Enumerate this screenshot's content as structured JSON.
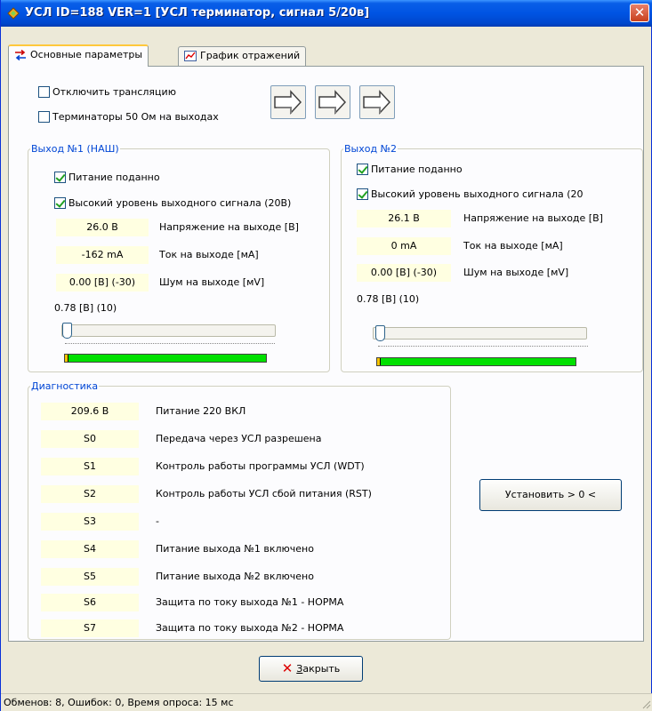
{
  "window": {
    "title": "УСЛ ID=188 VER=1 [УСЛ терминатор, сигнал 5/20в]",
    "close_glyph": "✕"
  },
  "tabs": [
    {
      "label": "Основные параметры",
      "active": true,
      "icon": "arrows-icon"
    },
    {
      "label": "График отражений",
      "active": false,
      "icon": "chart-icon"
    }
  ],
  "top_options": {
    "disable_translation": {
      "label": "Отключить трансляцию",
      "checked": false
    },
    "terminators": {
      "label": "Терминаторы 50 Ом на выходах",
      "checked": false
    }
  },
  "output1": {
    "legend": "Выход №1 (НАШ)",
    "power": {
      "label": "Питание поданно",
      "checked": true
    },
    "high_level": {
      "label": "Высокий уровень выходного сигнала (20В)",
      "checked": true
    },
    "rows": [
      {
        "value": "26.0 В",
        "label": "Напряжение на выходе  [В]"
      },
      {
        "value": "-162 mA",
        "label": "Ток на выходе  [мА]"
      },
      {
        "value": "0.00 [В] (-30)",
        "label": "Шум на выходе  [мV]"
      }
    ],
    "level_text": "0.78 [В] (10)",
    "slider_value": 0,
    "level_bar_fill": 1.0
  },
  "output2": {
    "legend": "Выход №2",
    "power": {
      "label": "Питание поданно",
      "checked": true
    },
    "high_level": {
      "label": "Высокий уровень выходного сигнала (20",
      "checked": true
    },
    "rows": [
      {
        "value": "26.1 В",
        "label": "Напряжение на выходе  [В]"
      },
      {
        "value": "0 mA",
        "label": "Ток на выходе  [мА]"
      },
      {
        "value": "0.00 [В] (-30)",
        "label": "Шум на выходе  [мV]"
      }
    ],
    "level_text": "0.78 [В] (10)",
    "slider_value": 0,
    "level_bar_fill": 1.0
  },
  "diagnostics": {
    "legend": "Диагностика",
    "rows": [
      {
        "code": "209.6 В",
        "text": "Питание 220 ВКЛ"
      },
      {
        "code": "S0",
        "text": "Передача через УСЛ разрешена"
      },
      {
        "code": "S1",
        "text": "Контроль работы программы УСЛ (WDT)"
      },
      {
        "code": "S2",
        "text": "Контроль работы  УСЛ сбой питания (RST)"
      },
      {
        "code": "S3",
        "text": "-"
      },
      {
        "code": "S4",
        "text": "Питание выхода №1 включено"
      },
      {
        "code": "S5",
        "text": "Питание выхода №2 включено"
      },
      {
        "code": "S6",
        "text": "Защита по току выхода №1 - НОРМА"
      },
      {
        "code": "S7",
        "text": "Защита по току выхода №2 - НОРМА"
      }
    ],
    "set_button": "Установить > 0 <"
  },
  "footer": {
    "close_mnemonic": "З",
    "close_rest": "акрыть"
  },
  "status": "Обменов: 8, Ошибок: 0, Время опроса: 15 мс",
  "colors": {
    "title_bar": "#0054e3",
    "value_bg": "#ffffe1",
    "level_bar": "#00e000",
    "group_legend": "#0046d5",
    "check_mark": "#21a121"
  }
}
